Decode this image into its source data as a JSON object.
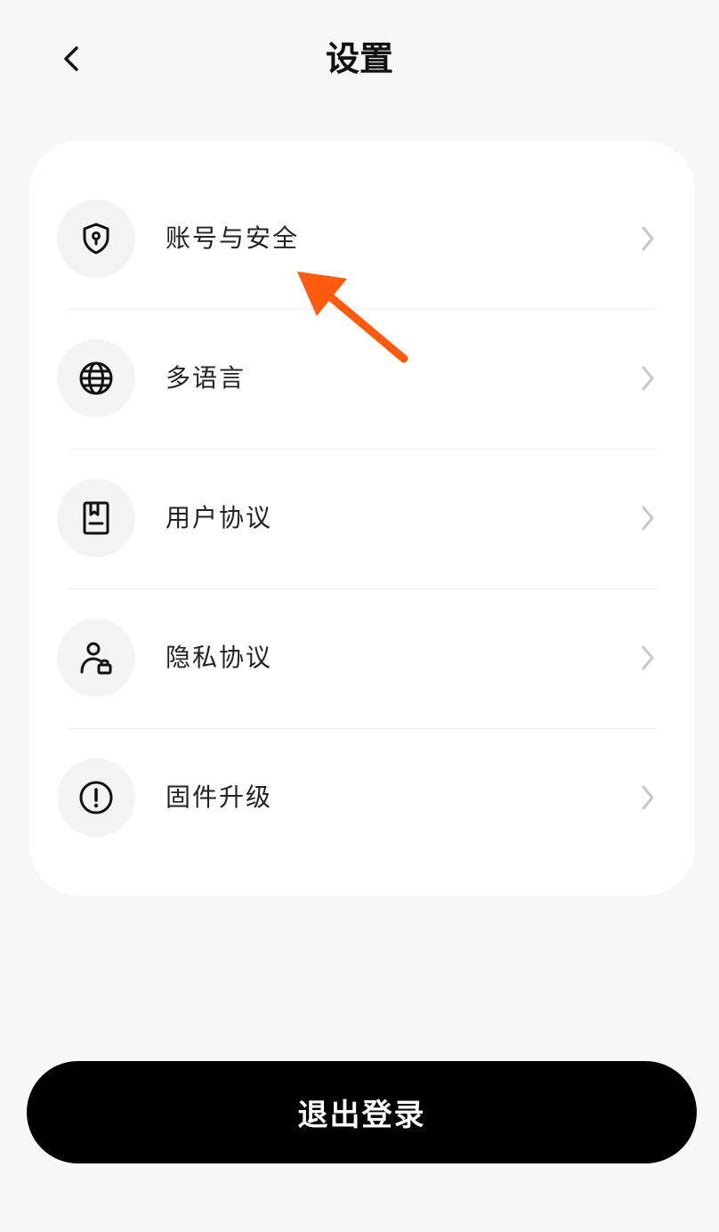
{
  "header": {
    "title": "设置",
    "back_icon": "chevron-left-icon"
  },
  "menu": {
    "items": [
      {
        "label": "账号与安全",
        "icon": "shield-keyhole-icon"
      },
      {
        "label": "多语言",
        "icon": "globe-icon"
      },
      {
        "label": "用户协议",
        "icon": "document-bookmark-icon"
      },
      {
        "label": "隐私协议",
        "icon": "user-lock-icon"
      },
      {
        "label": "固件升级",
        "icon": "alert-circle-icon"
      }
    ]
  },
  "annotation": {
    "arrow_color": "#ff5a0e"
  },
  "logout": {
    "label": "退出登录"
  },
  "colors": {
    "background": "#f7f7f7",
    "card": "#ffffff",
    "icon_bg": "#f4f4f4",
    "logout_bg": "#000000"
  }
}
